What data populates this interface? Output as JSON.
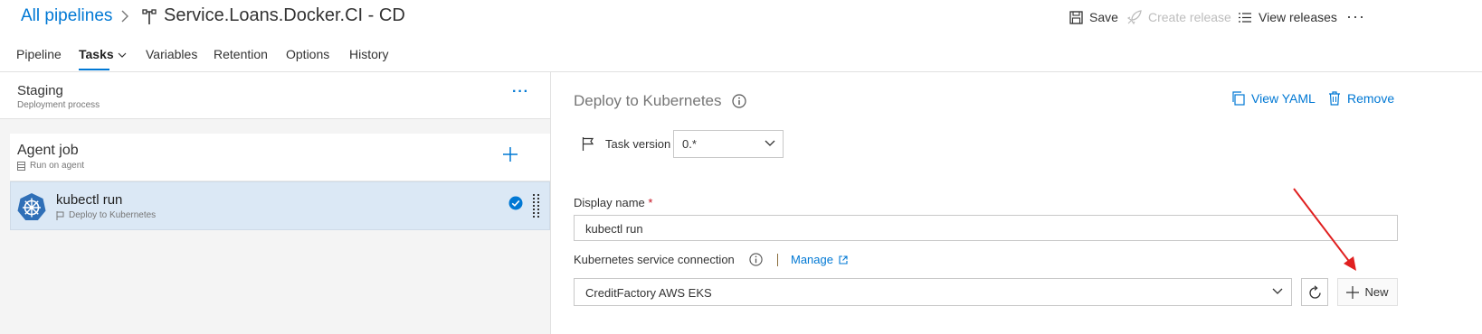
{
  "header": {
    "breadcrumb_label": "All pipelines",
    "title": "Service.Loans.Docker.CI - CD",
    "actions": {
      "save": "Save",
      "create_release": "Create release",
      "view_releases": "View releases",
      "more": "···"
    }
  },
  "tabs": [
    {
      "label": "Pipeline",
      "active": false
    },
    {
      "label": "Tasks",
      "active": true
    },
    {
      "label": "Variables",
      "active": false
    },
    {
      "label": "Retention",
      "active": false
    },
    {
      "label": "Options",
      "active": false
    },
    {
      "label": "History",
      "active": false
    }
  ],
  "left_pane": {
    "stage": {
      "name": "Staging",
      "subtitle": "Deployment process",
      "more": "···"
    },
    "agent_job": {
      "name": "Agent job",
      "subtitle": "Run on agent"
    },
    "task": {
      "name": "kubectl run",
      "subtitle": "Deploy to Kubernetes",
      "enabled": true
    }
  },
  "right_pane": {
    "title": "Deploy to Kubernetes",
    "actions": {
      "view_yaml": "View YAML",
      "remove": "Remove"
    },
    "task_version": {
      "label": "Task version",
      "value": "0.*"
    },
    "display_name": {
      "label": "Display name",
      "required_marker": "*",
      "value": "kubectl run"
    },
    "kubernetes_service_connection": {
      "label": "Kubernetes service connection",
      "manage_link": "Manage",
      "value": "CreditFactory AWS EKS",
      "new_button": "New"
    }
  },
  "colors": {
    "accent": "#0078d4",
    "selected_row": "#dbe8f5",
    "annotation_arrow": "#e02020",
    "disabled_text": "#bdbdbd"
  },
  "icons": [
    "chevron-right-icon",
    "pipeline-icon",
    "save-icon",
    "rocket-icon",
    "list-icon",
    "chevron-down-icon",
    "plus-icon",
    "server-icon",
    "kubernetes-icon",
    "flag-icon",
    "check-circle-icon",
    "grip-icon",
    "info-icon",
    "copy-icon",
    "trash-icon",
    "external-link-icon",
    "refresh-icon",
    "annotation-arrow"
  ]
}
